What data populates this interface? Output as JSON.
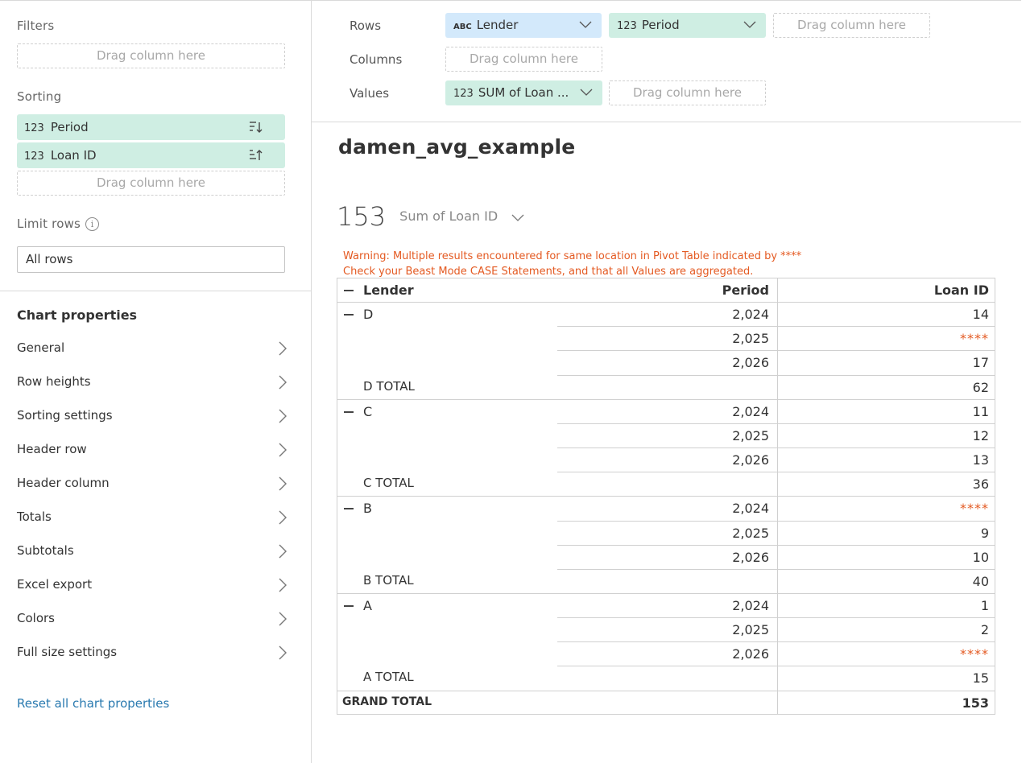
{
  "left": {
    "filters_title": "Filters",
    "drag_text": "Drag column here",
    "sorting_title": "Sorting",
    "sorting_items": [
      {
        "type": "123",
        "label": "Period"
      },
      {
        "type": "123",
        "label": "Loan ID"
      }
    ],
    "limit_title": "Limit rows",
    "limit_value": "All rows",
    "chart_props_title": "Chart properties",
    "props": [
      "General",
      "Row heights",
      "Sorting settings",
      "Header row",
      "Header column",
      "Totals",
      "Subtotals",
      "Excel export",
      "Colors",
      "Full size settings"
    ],
    "reset": "Reset all chart properties"
  },
  "config": {
    "rows_label": "Rows",
    "columns_label": "Columns",
    "values_label": "Values",
    "row_pills": [
      {
        "type": "ABC",
        "label": "Lender",
        "color": "#d3e9fb"
      },
      {
        "type": "123",
        "label": "Period",
        "color": "#cfeee3"
      }
    ],
    "value_pill": {
      "type": "123",
      "label": "SUM of Loan ..."
    },
    "drag_text": "Drag column here"
  },
  "main": {
    "title": "damen_avg_example",
    "summary_value": "153",
    "summary_label": "Sum of Loan ID",
    "warning_line1": "Warning: Multiple results encountered for same location in Pivot Table indicated by ****",
    "warning_line2": "Check your Beast Mode CASE Statements, and that all Values are aggregated.",
    "headers": {
      "lender": "Lender",
      "period": "Period",
      "loan": "Loan ID"
    },
    "groups": [
      {
        "lender": "D",
        "rows": [
          [
            "2,024",
            "14"
          ],
          [
            "2,025",
            "****"
          ],
          [
            "2,026",
            "17"
          ]
        ],
        "total_label": "D TOTAL",
        "total": "62"
      },
      {
        "lender": "C",
        "rows": [
          [
            "2,024",
            "11"
          ],
          [
            "2,025",
            "12"
          ],
          [
            "2,026",
            "13"
          ]
        ],
        "total_label": "C TOTAL",
        "total": "36"
      },
      {
        "lender": "B",
        "rows": [
          [
            "2,024",
            "****"
          ],
          [
            "2,025",
            "9"
          ],
          [
            "2,026",
            "10"
          ]
        ],
        "total_label": "B TOTAL",
        "total": "40"
      },
      {
        "lender": "A",
        "rows": [
          [
            "2,024",
            "1"
          ],
          [
            "2,025",
            "2"
          ],
          [
            "2,026",
            "****"
          ]
        ],
        "total_label": "A TOTAL",
        "total": "15"
      }
    ],
    "grand_total_label": "GRAND TOTAL",
    "grand_total": "153",
    "warning_color": "#e45a22"
  }
}
